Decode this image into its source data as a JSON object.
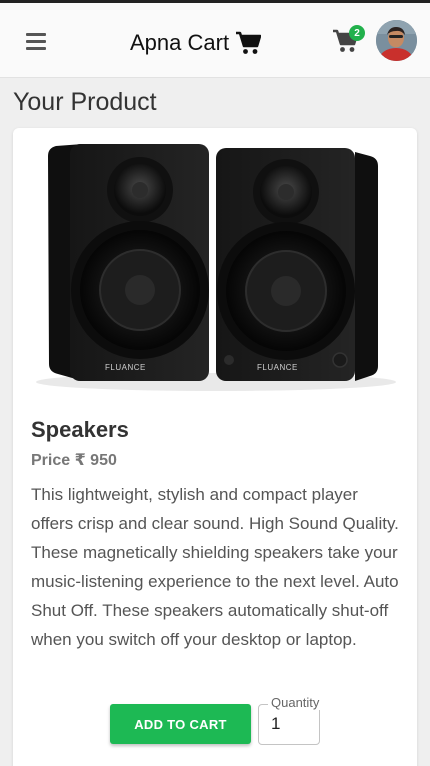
{
  "header": {
    "title": "Apna Cart",
    "cart_count": "2",
    "menu_icon": "hamburger-menu-icon",
    "title_icon": "shopping-cart-icon",
    "cart_icon": "shopping-cart-icon"
  },
  "page": {
    "title": "Your Product"
  },
  "product": {
    "name": "Speakers",
    "price_label": "Price ₹ 950",
    "brand_on_image": "FLUANCE",
    "description": "This lightweight, stylish and compact player offers crisp and clear sound. High Sound Quality. These magnetically shielding speakers take your music-listening experience to the next level. Auto Shut Off. These speakers automatically shut-off when you switch off your desktop or laptop."
  },
  "actions": {
    "add_to_cart_label": "ADD TO CART",
    "quantity_label": "Quantity",
    "quantity_value": "1"
  },
  "colors": {
    "accent_green": "#1db954",
    "badge_green": "#22b14c",
    "header_bg": "#fafafa",
    "page_bg": "#efefef"
  }
}
